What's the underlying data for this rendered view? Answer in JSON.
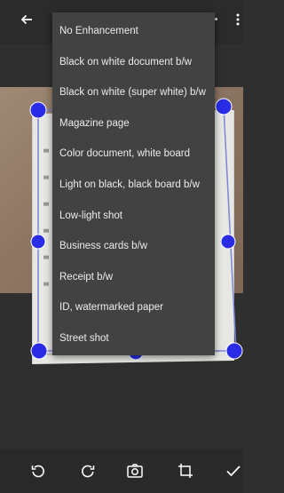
{
  "enhancement_menu": {
    "items": [
      "No Enhancement",
      "Black on white document b/w",
      "Black on white (super white) b/w",
      "Magazine page",
      "Color document, white board",
      "Light on black, black board b/w",
      "Low-light shot",
      "Business cards b/w",
      "Receipt b/w",
      "ID, watermarked paper",
      "Street shot"
    ]
  },
  "icons": {
    "back": "arrow-left-icon",
    "more": "more-vert-icon",
    "rotate_left": "rotate-left-icon",
    "rotate_right": "rotate-right-icon",
    "camera": "camera-icon",
    "crop": "crop-icon",
    "done": "check-icon"
  },
  "colors": {
    "handle": "#2a2ce8",
    "menu_bg": "#424242",
    "bar_bg": "#2b2b2b"
  }
}
